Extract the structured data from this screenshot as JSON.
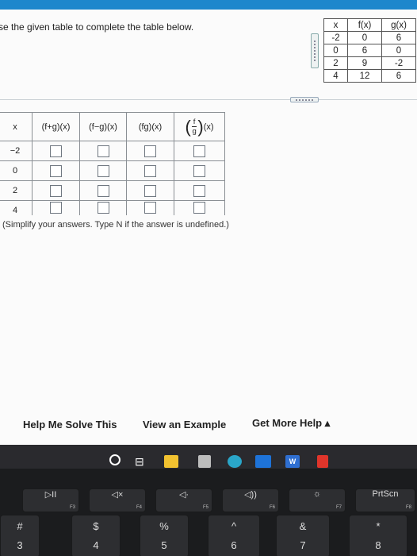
{
  "instruction": "se the given table to complete the table below.",
  "reference_table": {
    "headers": [
      "x",
      "f(x)",
      "g(x)"
    ],
    "rows": [
      [
        "-2",
        "0",
        "6"
      ],
      [
        "0",
        "6",
        "0"
      ],
      [
        "2",
        "9",
        "-2"
      ],
      [
        "4",
        "12",
        "6"
      ]
    ]
  },
  "answer_table": {
    "headers": [
      "x",
      "(f+g)(x)",
      "(f−g)(x)",
      "(fg)(x)"
    ],
    "quotient_header": {
      "numerator": "f",
      "denominator": "g",
      "suffix": "(x)"
    },
    "x_values": [
      "−2",
      "0",
      "2",
      "4"
    ]
  },
  "note": "(Simplify your answers. Type N if the answer is undefined.)",
  "help": {
    "help_me_solve": "Help Me Solve This",
    "view_example": "View an Example",
    "get_more_help": "Get More Help ▴"
  },
  "keyboard": {
    "function_keys": [
      {
        "label": "▷II",
        "fn": "F3"
      },
      {
        "label": "◁×",
        "fn": "F4"
      },
      {
        "label": "◁·",
        "fn": "F5"
      },
      {
        "label": "◁))",
        "fn": "F6"
      },
      {
        "label": "☼",
        "fn": "F7"
      },
      {
        "label": "PrtScn",
        "fn": "F8"
      }
    ],
    "number_keys": [
      {
        "sym": "#",
        "dig": "3"
      },
      {
        "sym": "$",
        "dig": "4"
      },
      {
        "sym": "%",
        "dig": "5"
      },
      {
        "sym": "^",
        "dig": "6"
      },
      {
        "sym": "&",
        "dig": "7"
      },
      {
        "sym": "*",
        "dig": "8"
      }
    ]
  },
  "colors": {
    "accent_bar": "#1d87cc",
    "taskbar": "#2a2a2e"
  },
  "icons": [
    "circle-search-icon",
    "task-view-icon",
    "file-explorer-icon",
    "store-icon",
    "edge-icon",
    "mail-icon",
    "word-icon",
    "office-icon"
  ]
}
